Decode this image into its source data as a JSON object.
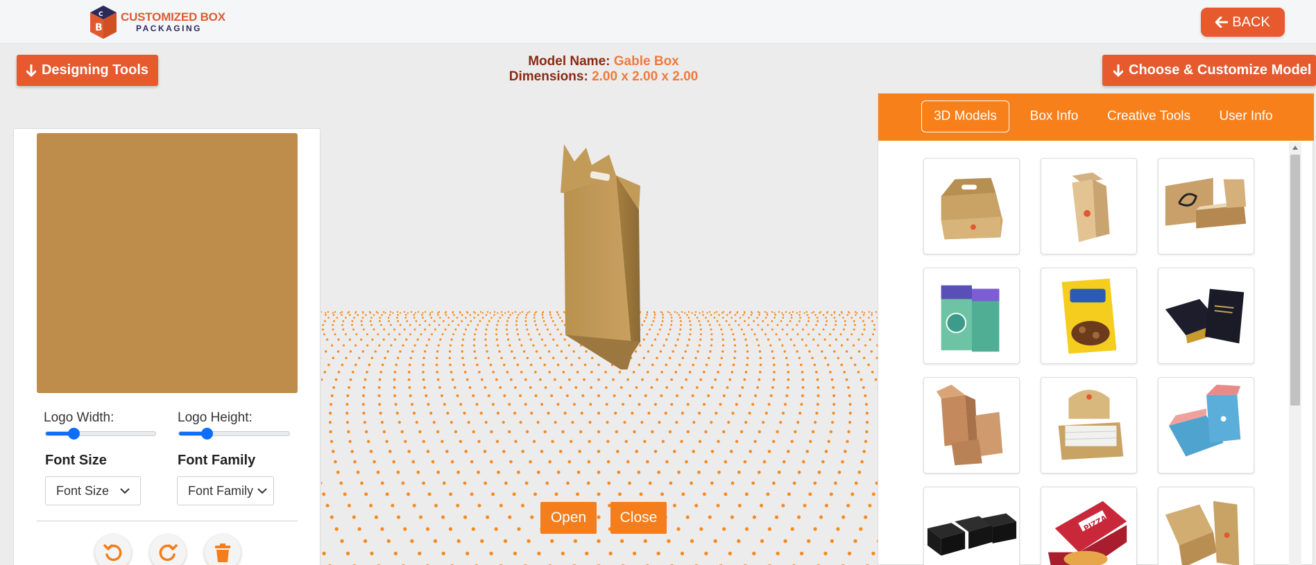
{
  "brand": {
    "line1": "CUSTOMIZED BOX",
    "line2": "PACKAGING"
  },
  "header": {
    "back_label": "BACK"
  },
  "toolbar": {
    "designing_tools_label": "Designing Tools",
    "choose_model_label": "Choose & Customize Model"
  },
  "model": {
    "name_label": "Model Name:",
    "name_value": "Gable Box",
    "dims_label": "Dimensions:",
    "dims_value": "2.00 x 2.00 x 2.00"
  },
  "left_panel": {
    "preview_color": "#be8c4b",
    "logo_width_label": "Logo Width:",
    "logo_width_level": 0.25,
    "logo_height_label": "Logo Height:",
    "logo_height_level": 0.25,
    "font_size_label": "Font Size",
    "font_size_value": "Font Size",
    "font_family_label": "Font Family",
    "font_family_value": "Font Family",
    "actions": [
      "undo-icon",
      "redo-icon",
      "trash-icon"
    ]
  },
  "scene": {
    "open_label": "Open",
    "close_label": "Close"
  },
  "right_panel": {
    "tabs": [
      {
        "label": "3D Models",
        "active": true
      },
      {
        "label": "Box Info",
        "active": false
      },
      {
        "label": "Creative Tools",
        "active": false
      },
      {
        "label": "User Info",
        "active": false
      }
    ],
    "models": [
      "gable-box",
      "tuck-end-box",
      "mailer-box",
      "display-pack-box",
      "snack-counter-box",
      "black-premium-box",
      "kraft-box-set",
      "counter-display-box",
      "blue-folding-box",
      "black-rigid-boxes",
      "pizza-box",
      "kraft-sleeve-box"
    ],
    "pizza_text": "PIZZA"
  },
  "colors": {
    "accent": "#e65a2e",
    "tab_orange": "#f7801b",
    "button_orange": "#f47d1c",
    "title_dark": "#8a2a12",
    "title_value": "#f07a3c"
  }
}
